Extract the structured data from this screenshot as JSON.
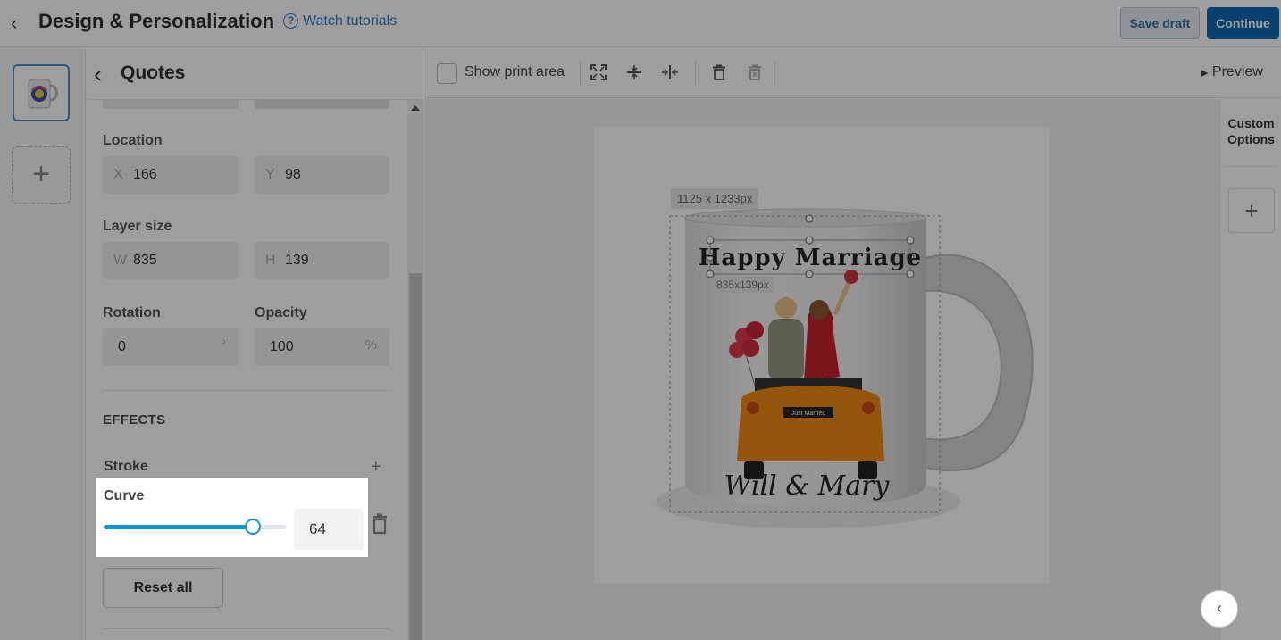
{
  "header": {
    "title": "Design & Personalization",
    "tutorials_label": "Watch tutorials",
    "help_glyph": "?",
    "save_label": "Save draft",
    "continue_label": "Continue"
  },
  "panel": {
    "title": "Quotes",
    "location_label": "Location",
    "x_prefix": "X",
    "x_value": "166",
    "y_prefix": "Y",
    "y_value": "98",
    "layer_size_label": "Layer size",
    "w_prefix": "W",
    "w_value": "835",
    "h_prefix": "H",
    "h_value": "139",
    "rotation_label": "Rotation",
    "rotation_value": "0",
    "rotation_unit": "°",
    "opacity_label": "Opacity",
    "opacity_value": "100",
    "opacity_unit": "%",
    "effects_label": "EFFECTS",
    "stroke_label": "Stroke",
    "curve_label": "Curve",
    "curve_value": "64",
    "curve_slider_fraction": 0.82,
    "reset_label": "Reset all"
  },
  "toolbar": {
    "show_print_label": "Show print area",
    "preview_label": "Preview",
    "preview_glyph": "▶"
  },
  "canvas": {
    "artboard_size": "1125 x 1233px",
    "layer_size": "835x139px",
    "headline": "Happy Marriage",
    "names": "Will & Mary",
    "plate": "Just Married"
  },
  "rightside": {
    "custom_options_line1": "Custom",
    "custom_options_line2": "Options"
  },
  "colors": {
    "accent": "#1294d8",
    "continue_bg": "#0a6ab5",
    "link": "#2f7fc1"
  }
}
